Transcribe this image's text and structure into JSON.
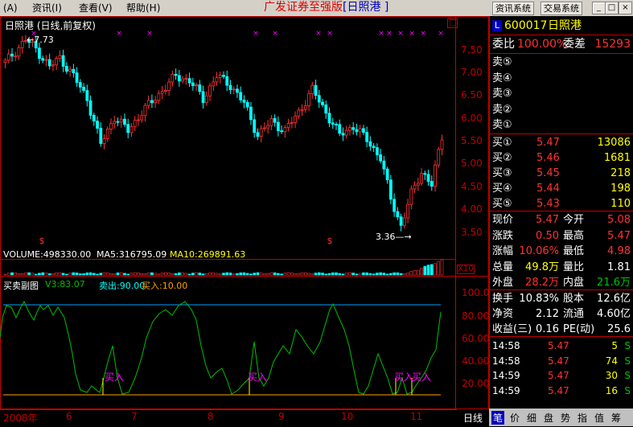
{
  "menu": {
    "items": [
      "(A)",
      "资讯(I)",
      "查看(V)",
      "帮助(H)"
    ],
    "app_title": "广发证券至强版",
    "app_sub": "[日照港 ]",
    "sys_buttons": [
      "资讯系统",
      "交易系统"
    ],
    "window_buttons": [
      "_",
      "□",
      "×"
    ]
  },
  "chart_header": "日照港 (日线,前复权)",
  "price_axis": [
    "7.50",
    "7.00",
    "6.50",
    "6.00",
    "5.50",
    "5.00",
    "4.50",
    "4.00",
    "3.50"
  ],
  "high_label": "7.73",
  "low_label": "3.36",
  "volume_header": {
    "volume": "VOLUME:498330.00",
    "ma5": "MA5:316795.09",
    "ma10": "MA10:269891.63",
    "scale": "X10"
  },
  "indicator_header": {
    "name": "买卖副图",
    "v3": "V3:83.07",
    "sell": "卖出:90.00",
    "buy": "买入:10.00"
  },
  "indicator_axis": [
    "100.00",
    "80.00",
    "60.00",
    "40.00",
    "20.00"
  ],
  "buy_signal": "买入",
  "date_axis": [
    "2008年",
    "6",
    "7",
    "8",
    "9",
    "10",
    "11"
  ],
  "period_tab": "日线",
  "colors": {
    "up": "#ff3232",
    "down": "#00ffff",
    "green": "#00c000",
    "yellow": "#ffff00",
    "magenta": "#ff00ff",
    "frame": "#c00000"
  },
  "quote": {
    "code_badge": "L",
    "code": "600017",
    "name": "日照港",
    "weibi_label": "委比",
    "weibi_value": "100.00%",
    "weicha_label": "委差",
    "weicha_value": "15293",
    "asks": [
      {
        "label": "卖⑤"
      },
      {
        "label": "卖④"
      },
      {
        "label": "卖③"
      },
      {
        "label": "卖②"
      },
      {
        "label": "卖①"
      }
    ],
    "bids": [
      {
        "label": "买①",
        "price": "5.47",
        "vol": "13086"
      },
      {
        "label": "买②",
        "price": "5.46",
        "vol": "1681"
      },
      {
        "label": "买③",
        "price": "5.45",
        "vol": "218"
      },
      {
        "label": "买④",
        "price": "5.44",
        "vol": "198"
      },
      {
        "label": "买⑤",
        "price": "5.43",
        "vol": "110"
      }
    ],
    "stats": [
      {
        "l1": "现价",
        "v1": "5.47",
        "l2": "今开",
        "v2": "5.08"
      },
      {
        "l1": "涨跌",
        "v1": "0.50",
        "l2": "最高",
        "v2": "5.47"
      },
      {
        "l1": "涨幅",
        "v1": "10.06%",
        "l2": "最低",
        "v2": "4.98"
      },
      {
        "l1": "总量",
        "v1": "49.8万",
        "l2": "量比",
        "v2": "1.81"
      },
      {
        "l1": "外盘",
        "v1": "28.2万",
        "l2": "内盘",
        "v2": "21.6万"
      }
    ],
    "fund": [
      {
        "l1": "换手",
        "v1": "10.83%",
        "l2": "股本",
        "v2": "12.6亿"
      },
      {
        "l1": "净资",
        "v1": "2.12",
        "l2": "流通",
        "v2": "4.60亿"
      },
      {
        "l1": "收益(三)",
        "v1": "0.16",
        "l2": "PE(动)",
        "v2": "25.6"
      }
    ],
    "ticks": [
      {
        "time": "14:58",
        "price": "5.47",
        "vol": "5",
        "side": "S"
      },
      {
        "time": "14:58",
        "price": "5.47",
        "vol": "74",
        "side": "S"
      },
      {
        "time": "14:59",
        "price": "5.47",
        "vol": "30",
        "side": "S"
      },
      {
        "time": "14:59",
        "price": "5.47",
        "vol": "16",
        "side": "S"
      }
    ]
  },
  "right_tabs": [
    "笔",
    "价",
    "细",
    "盘",
    "势",
    "指",
    "值",
    "筹"
  ]
}
